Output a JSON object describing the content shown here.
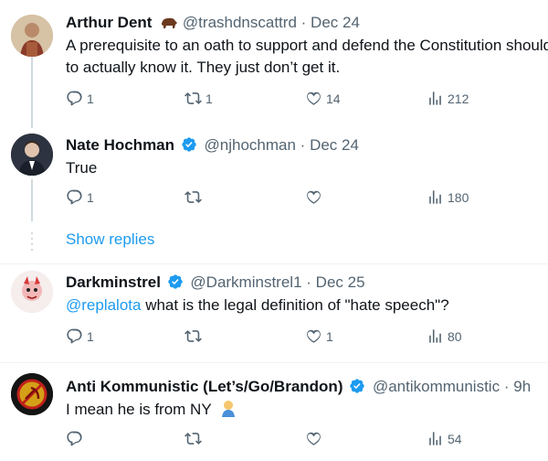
{
  "tweets": [
    {
      "name": "Arthur Dent",
      "handle": "@trashdnscattrd",
      "dot": "·",
      "date": "Dec 24",
      "text_line1": "A prerequisite to an oath to support and defend the Constitution should be",
      "text_line2": "to actually know it. They just don’t get it.",
      "replies": "1",
      "retweets": "1",
      "likes": "14",
      "views": "212"
    },
    {
      "name": "Nate Hochman",
      "handle": "@njhochman",
      "dot": "·",
      "date": "Dec 24",
      "text": "True",
      "replies": "1",
      "retweets": "",
      "likes": "",
      "views": "180"
    },
    {
      "name": "Darkminstrel",
      "handle": "@Darkminstrel1",
      "dot": "·",
      "date": "Dec 25",
      "mention": "@replalota",
      "text": " what is the legal definition of \"hate speech\"?",
      "replies": "1",
      "retweets": "",
      "likes": "1",
      "views": "80"
    },
    {
      "name": "Anti Kommunistic (Let’s/Go/Brandon)",
      "handle": "@antikommunistic",
      "dot": "·",
      "date": "9h",
      "text": "I mean he is from NY",
      "replies": "",
      "retweets": "",
      "likes": "",
      "views": "54"
    }
  ],
  "show_replies": "Show replies",
  "colors": {
    "accent": "#1d9bf0",
    "muted": "#536471",
    "line": "#cfd9de"
  },
  "icons": [
    "reply-icon",
    "retweet-icon",
    "like-icon",
    "views-icon",
    "verified-icon",
    "bison-emoji-icon",
    "person-emoji-icon"
  ]
}
